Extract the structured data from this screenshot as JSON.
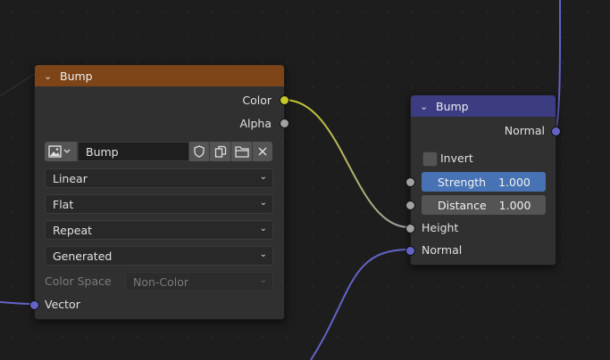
{
  "colors": {
    "image_header": "#7d4418",
    "bump_header": "#3c3c83",
    "wire_yellow": "#c7c729",
    "wire_grey": "#a1a1a1",
    "wire_blue": "#6363c7",
    "strength_field": "#4772b3"
  },
  "image_node": {
    "title": "Bump",
    "outputs": [
      "Color",
      "Alpha"
    ],
    "image_name": "Bump",
    "interpolation": "Linear",
    "projection": "Flat",
    "extension": "Repeat",
    "source": "Generated",
    "color_space_label": "Color Space",
    "color_space_value": "Non-Color",
    "input_vector": "Vector"
  },
  "bump_node": {
    "title": "Bump",
    "output_normal": "Normal",
    "invert_label": "Invert",
    "strength_label": "Strength",
    "strength_value": "1.000",
    "distance_label": "Distance",
    "distance_value": "1.000",
    "height_label": "Height",
    "normal_input_label": "Normal"
  }
}
